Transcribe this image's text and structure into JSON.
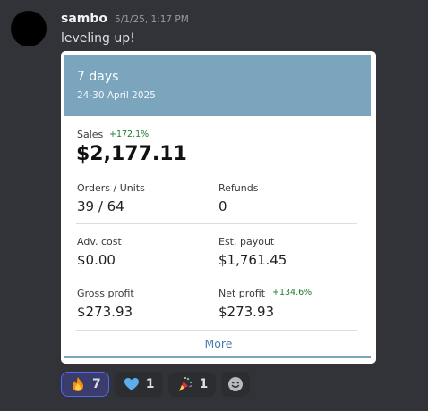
{
  "message": {
    "username": "sambo",
    "timestamp": "5/1/25, 1:17 PM",
    "text": "leveling up!"
  },
  "embed": {
    "title": "7 days",
    "subtitle": "24-30 April 2025",
    "sales": {
      "label": "Sales",
      "change": "+172.1%",
      "value": "$2,177.11"
    },
    "orders_units": {
      "label": "Orders / Units",
      "value": "39 / 64"
    },
    "refunds": {
      "label": "Refunds",
      "value": "0"
    },
    "adv_cost": {
      "label": "Adv. cost",
      "value": "$0.00"
    },
    "est_payout": {
      "label": "Est. payout",
      "value": "$1,761.45"
    },
    "gross_profit": {
      "label": "Gross profit",
      "value": "$273.93"
    },
    "net_profit": {
      "label": "Net profit",
      "change": "+134.6%",
      "value": "$273.93"
    },
    "more_label": "More",
    "accent_color": "#7aa5bc"
  },
  "reactions": [
    {
      "emoji": "fire-emoji",
      "count": "7"
    },
    {
      "emoji": "blue-heart-emoji",
      "count": "1"
    },
    {
      "emoji": "party-popper-emoji",
      "count": "1"
    }
  ],
  "add_reaction_icon": "smiley-icon"
}
